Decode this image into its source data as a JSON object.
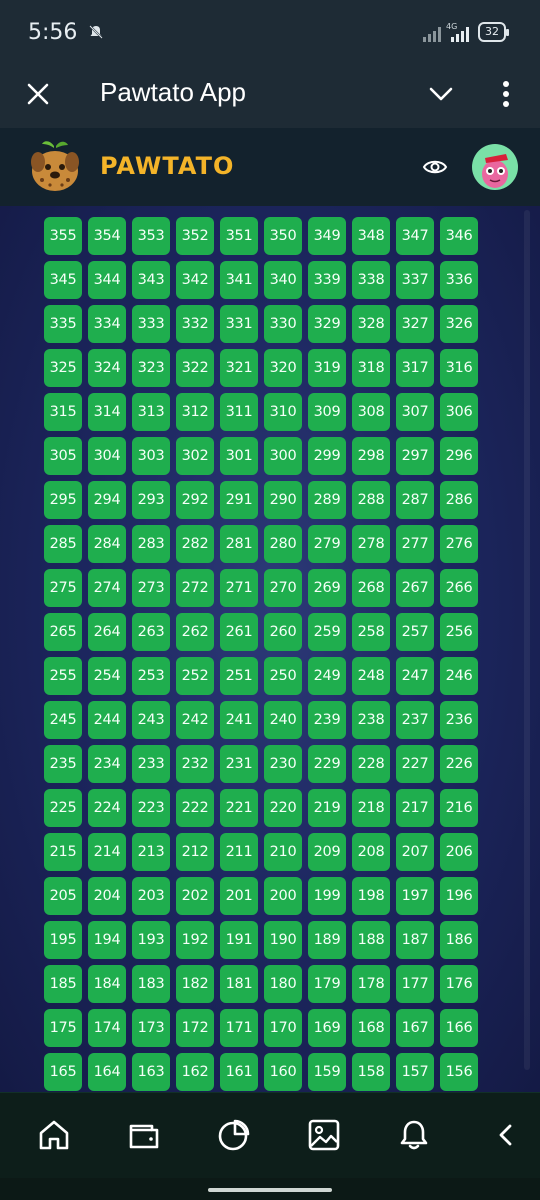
{
  "status_bar": {
    "time": "5:56",
    "network": "4G",
    "battery": "32"
  },
  "header": {
    "title": "Pawtato App"
  },
  "brand": {
    "name": "PAWTATO"
  },
  "grid": {
    "numbers": [
      355,
      354,
      353,
      352,
      351,
      350,
      349,
      348,
      347,
      346,
      345,
      344,
      343,
      342,
      341,
      340,
      339,
      338,
      337,
      336,
      335,
      334,
      333,
      332,
      331,
      330,
      329,
      328,
      327,
      326,
      325,
      324,
      323,
      322,
      321,
      320,
      319,
      318,
      317,
      316,
      315,
      314,
      313,
      312,
      311,
      310,
      309,
      308,
      307,
      306,
      305,
      304,
      303,
      302,
      301,
      300,
      299,
      298,
      297,
      296,
      295,
      294,
      293,
      292,
      291,
      290,
      289,
      288,
      287,
      286,
      285,
      284,
      283,
      282,
      281,
      280,
      279,
      278,
      277,
      276,
      275,
      274,
      273,
      272,
      271,
      270,
      269,
      268,
      267,
      266,
      265,
      264,
      263,
      262,
      261,
      260,
      259,
      258,
      257,
      256,
      255,
      254,
      253,
      252,
      251,
      250,
      249,
      248,
      247,
      246,
      245,
      244,
      243,
      242,
      241,
      240,
      239,
      238,
      237,
      236,
      235,
      234,
      233,
      232,
      231,
      230,
      229,
      228,
      227,
      226,
      225,
      224,
      223,
      222,
      221,
      220,
      219,
      218,
      217,
      216,
      215,
      214,
      213,
      212,
      211,
      210,
      209,
      208,
      207,
      206,
      205,
      204,
      203,
      202,
      201,
      200,
      199,
      198,
      197,
      196,
      195,
      194,
      193,
      192,
      191,
      190,
      189,
      188,
      187,
      186,
      185,
      184,
      183,
      182,
      181,
      180,
      179,
      178,
      177,
      176,
      175,
      174,
      173,
      172,
      171,
      170,
      169,
      168,
      167,
      166,
      165,
      164,
      163,
      162,
      161,
      160,
      159,
      158,
      157,
      156
    ],
    "cell_color": "#1fae4e"
  },
  "nav": {
    "icons": [
      "home-icon",
      "wallet-icon",
      "pie-chart-icon",
      "image-icon",
      "bell-icon",
      "chevron-left-icon"
    ]
  },
  "colors": {
    "accent": "#f4b429",
    "tile": "#1fae4e",
    "header_bg": "#1e2b35"
  }
}
